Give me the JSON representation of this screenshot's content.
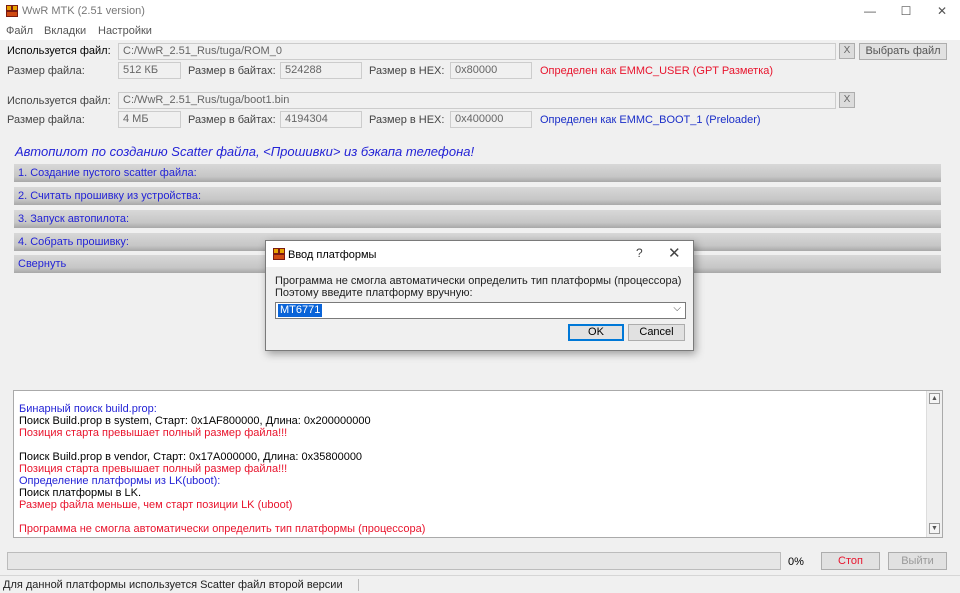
{
  "window": {
    "title": "WwR MTK (2.51 version)",
    "minimize": "—",
    "maximize": "☐",
    "close": "✕"
  },
  "menu": [
    "Файл",
    "Вкладки",
    "Настройки"
  ],
  "file1": {
    "used_label": "Используется файл:",
    "path": "C:/WwR_2.51_Rus/tuga/ROM_0",
    "clear": "X",
    "choose": "Выбрать файл",
    "size_label": "Размер файла:",
    "size": "512 КБ",
    "bytes_label": "Размер в байтах:",
    "bytes": "524288",
    "hex_label": "Размер в HEX:",
    "hex": "0x80000",
    "status": "Определен как EMMC_USER (GPT Разметка)",
    "status_color": "#e8142d"
  },
  "file2": {
    "used_label": "Используется файл:",
    "path": "C:/WwR_2.51_Rus/tuga/boot1.bin",
    "clear": "X",
    "size_label": "Размер файла:",
    "size": "4 МБ",
    "bytes_label": "Размер в байтах:",
    "bytes": "4194304",
    "hex_label": "Размер в HEX:",
    "hex": "0x400000",
    "status": "Определен как EMMC_BOOT_1 (Preloader)",
    "status_color": "#1a2ec8"
  },
  "autopilot": {
    "title": "Автопилот по созданию Scatter файла, <Прошивки> из бэкапа телефона!",
    "steps": [
      "1. Создание пустого scatter файла:",
      "2. Считать прошивку из устройства:",
      "3. Запуск автопилота:",
      "4. Собрать прошивку:",
      "Свернуть"
    ]
  },
  "log": [
    {
      "text": "Бинарный поиск build.prop:",
      "color": "blue"
    },
    {
      "text": "Поиск Build.prop в system, Старт: 0x1AF800000, Длина: 0x200000000",
      "color": "black"
    },
    {
      "text": "Позиция старта превышает полный размер файла!!!",
      "color": "red"
    },
    {
      "text": "",
      "color": "black"
    },
    {
      "text": "Поиск Build.prop в vendor, Старт: 0x17A000000, Длина: 0x35800000",
      "color": "black"
    },
    {
      "text": "Позиция старта превышает полный размер файла!!!",
      "color": "red"
    },
    {
      "text": "Определение платформы из LK(uboot):",
      "color": "blue"
    },
    {
      "text": "Поиск платформы в LK.",
      "color": "black"
    },
    {
      "text": "Размер файла меньше, чем старт позиции LK (uboot)",
      "color": "red"
    },
    {
      "text": "",
      "color": "black"
    },
    {
      "text": "Программа не смогла автоматически определить тип платформы (процессора)",
      "color": "red"
    }
  ],
  "progress": {
    "percent_label": "0%",
    "value": 0,
    "stop": "Стоп",
    "exit": "Выйти"
  },
  "statusbar": {
    "text": "Для данной платформы используется Scatter файл второй версии"
  },
  "dialog": {
    "title": "Ввод платформы",
    "help": "?",
    "close": "✕",
    "message_line1": "Программа не смогла автоматически определить тип платформы (процессора)",
    "message_line2": "Поэтому введите платформу вручную:",
    "value": "MT6771",
    "ok": "OK",
    "cancel": "Cancel"
  }
}
